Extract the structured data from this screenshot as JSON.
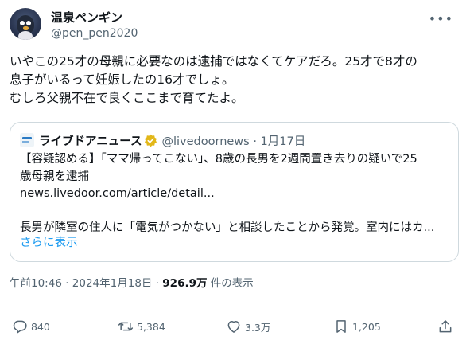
{
  "user": {
    "name": "温泉ペンギン",
    "handle": "@pen_pen2020"
  },
  "tweet": {
    "text": "いやこの25才の母親に必要なのは逮捕ではなくてケアだろ。25才で8才の\n息子がいるって妊娠したの16才でしょ。\nむしろ父親不在で良くここまで育てたよ。"
  },
  "quote": {
    "source_name": "ライブドアニュース",
    "source_handle": "@livedoornews · 1月17日",
    "text": "【容疑認める】「ママ帰ってこない」、8歳の長男を2週間置き去りの疑いで25\n歳母親を逮捕\nnews.livedoor.com/article/detail...\n\n長男が隣室の住人に「電気がつかない」と相談したことから発覚。室内にはカ...",
    "show_more": "さらに表示"
  },
  "meta": {
    "timestamp": "午前10:46 · 2024年1月18日 · ",
    "views": "926.9万",
    "views_suffix": " 件の表示"
  },
  "actions": {
    "replies": "840",
    "retweets": "5,384",
    "likes": "3.3万",
    "bookmarks": "1,205"
  },
  "colors": {
    "accent": "#1d9bf0",
    "secondary_text": "#536471",
    "verified": "#e2b719"
  }
}
